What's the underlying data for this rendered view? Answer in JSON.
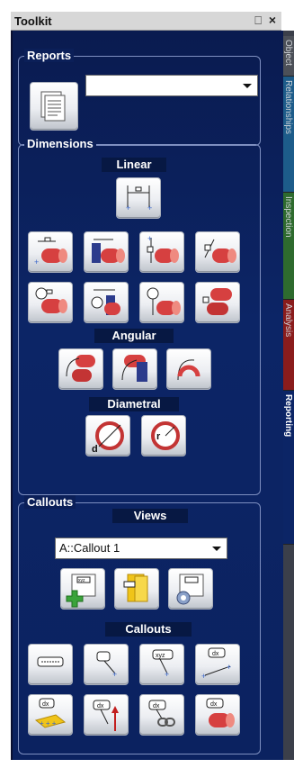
{
  "window": {
    "title": "Toolkit",
    "pin_glyph": "⎕",
    "close_glyph": "×"
  },
  "tabs": [
    "Object",
    "Relationships",
    "Inspection",
    "Analysis",
    "Reporting"
  ],
  "tab_colors": {
    "object": "#4c5058",
    "relationships": "#1d5c8a",
    "inspection": "#2e6b2e",
    "analysis": "#8a1c1c",
    "reporting": "#0c2566"
  },
  "reports": {
    "label": "Reports",
    "dropdown_value": ""
  },
  "dimensions": {
    "label": "Dimensions",
    "linear": "Linear",
    "angular": "Angular",
    "diametral": "Diametral"
  },
  "callouts_group": {
    "label": "Callouts",
    "views_label": "Views",
    "views_value": "A::Callout 1",
    "callouts_label": "Callouts"
  },
  "icons": {
    "report": "report-icon",
    "linear_distance": "linear-distance-icon",
    "angle": "angle-icon",
    "diameter": "diameter-icon",
    "radius": "radius-icon",
    "new_view": "new-view-icon",
    "view_properties": "view-properties-icon",
    "text_callout": "text-callout-icon",
    "label_callout": "label-callout-icon"
  },
  "callout_texts": {
    "xyz": "xyz",
    "dx": "dx"
  }
}
